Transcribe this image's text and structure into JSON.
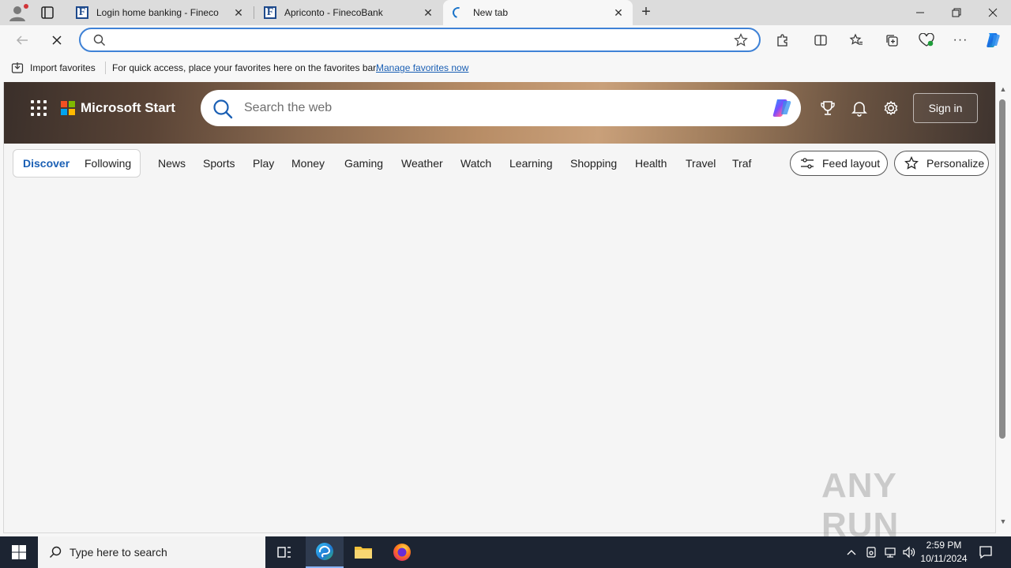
{
  "browser": {
    "tabs": [
      {
        "label": "Login home banking - Fineco",
        "favicon": "fineco-icon"
      },
      {
        "label": "Apriconto - FinecoBank",
        "favicon": "fineco-icon"
      },
      {
        "label": "New tab",
        "favicon": "loading-spinner-icon",
        "active": true
      }
    ],
    "address": {
      "value": "",
      "placeholder": ""
    },
    "favorites_bar": {
      "import_label": "Import favorites",
      "hint": "For quick access, place your favorites here on the favorites bar.",
      "manage_link": "Manage favorites now"
    }
  },
  "newtab": {
    "brand": "Microsoft Start",
    "search_placeholder": "Search the web",
    "sign_in": "Sign in",
    "feed_tabs": {
      "discover": "Discover",
      "following": "Following"
    },
    "nav": [
      "News",
      "Sports",
      "Play",
      "Money",
      "Gaming",
      "Weather",
      "Watch",
      "Learning",
      "Shopping",
      "Health",
      "Travel",
      "Traf"
    ],
    "feed_layout": "Feed layout",
    "personalize": "Personalize"
  },
  "watermark": "ANY RUN",
  "taskbar": {
    "search_placeholder": "Type here to search",
    "time": "2:59 PM",
    "date": "10/11/2024"
  },
  "colors": {
    "accent": "#1a5fb4",
    "taskbar_bg": "#1c2432",
    "ms_red": "#f25022",
    "ms_green": "#7fba00",
    "ms_blue": "#00a4ef",
    "ms_yellow": "#ffb900"
  }
}
